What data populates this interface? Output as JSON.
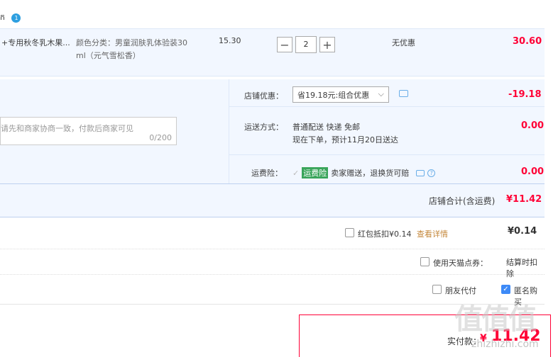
{
  "header": {
    "title_fragment": "ក",
    "badge": "1"
  },
  "item": {
    "title": "+专用秋冬乳木果...",
    "sku_line1": "颜色分类：男童润肤乳体验装30",
    "sku_line2": "ml（元气雪松香）",
    "price": "15.30",
    "quantity": "2",
    "minus": "−",
    "plus": "+",
    "discount": "无优惠",
    "subtotal": "30.60"
  },
  "shop": {
    "promo_label": "店铺优惠：",
    "promo_select": "省19.18元:组合优惠",
    "promo_value": "-19.18",
    "message_placeholder": "请先和商家协商一致，付款后商家可见",
    "message_count": "0/200",
    "shipping_label": "运送方式：",
    "shipping_method": "普通配送 快递 免邮",
    "shipping_eta": "现在下单，预计11月20日送达",
    "shipping_value": "0.00",
    "insurance_label": "运费险：",
    "insurance_tag": "运费险",
    "insurance_text": "卖家赠送，退换货可赔",
    "insurance_value": "0.00",
    "total_label": "店铺合计(含运费)",
    "total_value": "¥11.42"
  },
  "redpacket": {
    "label": "红包抵扣¥0.14",
    "link": "查看详情",
    "value": "¥0.14"
  },
  "tmall_points": {
    "label": "使用天猫点券：",
    "note": "结算时扣除"
  },
  "options": {
    "friend_pay": "朋友代付",
    "anonymous": "匿名购买"
  },
  "payment": {
    "label": "实付款：",
    "currency": "¥",
    "amount": "11.42"
  },
  "watermark": {
    "text": "值值值",
    "url": "zhizhizhi.com"
  },
  "colors": {
    "accent": "#ff0036",
    "blue_bg": "#f2f7ff",
    "border": "#dcdcdc",
    "link": "#c5883c"
  }
}
